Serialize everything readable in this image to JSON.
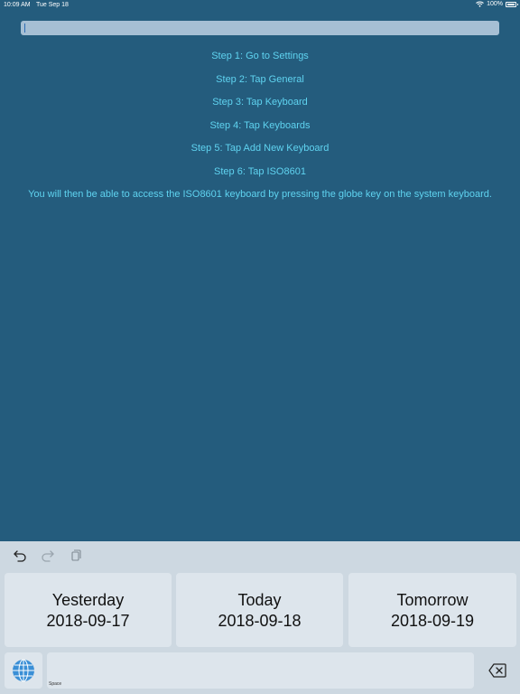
{
  "status_bar": {
    "time": "10:09 AM",
    "date": "Tue Sep 18",
    "battery": "100%",
    "icons": [
      "wifi-icon",
      "battery-icon"
    ]
  },
  "text_field": {
    "value": ""
  },
  "instructions": {
    "steps": [
      "Step 1: Go to Settings",
      "Step 2: Tap General",
      "Step 3: Tap Keyboard",
      "Step 4: Tap Keyboards",
      "Step 5: Tap Add New Keyboard",
      "Step 6: Tap ISO8601"
    ],
    "note": "You will then be able to access the ISO8601 keyboard by pressing the globe key on the system keyboard."
  },
  "keyboard": {
    "toolbar_icons": [
      "undo-icon",
      "redo-icon",
      "paste-icon"
    ],
    "date_keys": [
      {
        "label": "Yesterday",
        "date": "2018-09-17"
      },
      {
        "label": "Today",
        "date": "2018-09-18"
      },
      {
        "label": "Tomorrow",
        "date": "2018-09-19"
      }
    ],
    "space_label": "Space",
    "bottom_icons": [
      "globe-icon",
      "delete-icon"
    ]
  },
  "colors": {
    "background": "#245c7d",
    "instruction_text": "#5fd3f0",
    "text_field": "#a6bfd4",
    "keyboard_background": "#cdd8e1",
    "key_background": "#dde5ec"
  }
}
